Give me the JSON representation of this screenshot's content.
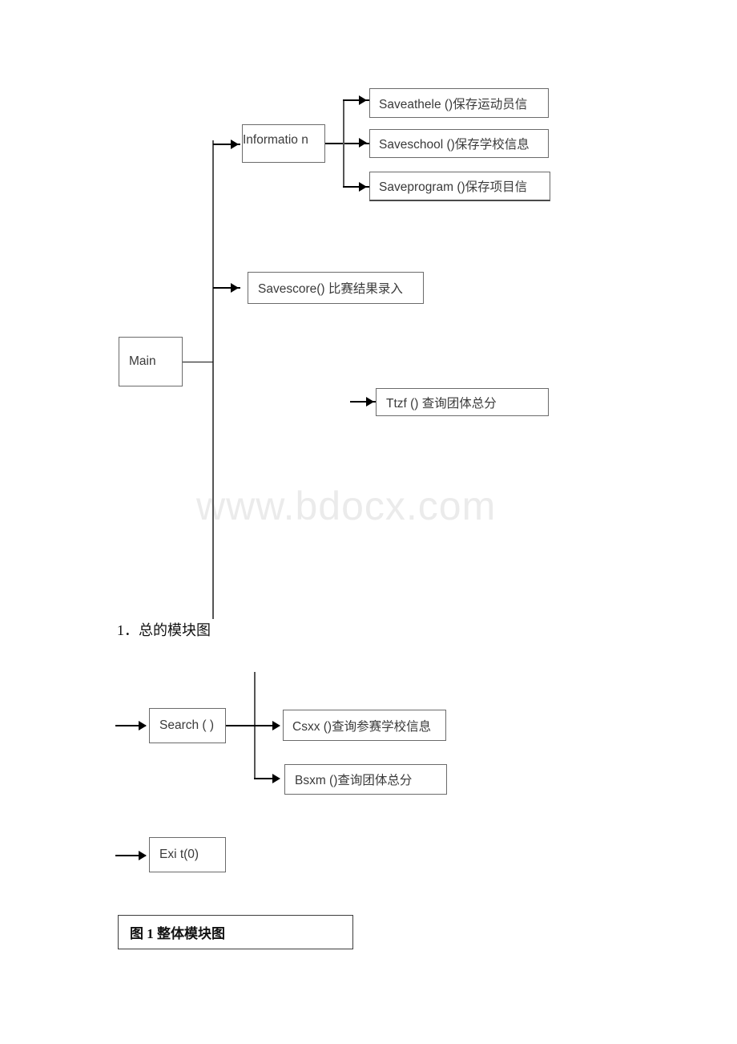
{
  "document": {
    "watermark": "www.bdocx.com"
  },
  "diagram_one": {
    "root": {
      "label": "Main"
    },
    "branches": [
      {
        "label": "Informatio n"
      },
      {
        "label": "Savescore()  比赛结果录入"
      }
    ],
    "information_children": [
      {
        "label": "Saveathele  ()保存运动员信"
      },
      {
        "label": "Saveschool ()保存学校信息"
      },
      {
        "label": "Saveprogram  ()保存项目信"
      }
    ],
    "standalone": [
      {
        "label": "Ttzf ()  查询团体总分"
      }
    ],
    "caption": "1．总的模块图"
  },
  "diagram_two": {
    "root": {
      "label": "Search ( )"
    },
    "children": [
      {
        "label": "Csxx ()查询参赛学校信息"
      },
      {
        "label": "Bsxm ()查询团体总分"
      }
    ],
    "standalone": [
      {
        "label": "Exi t(0)"
      }
    ],
    "caption": "图 1  整体模块图"
  }
}
